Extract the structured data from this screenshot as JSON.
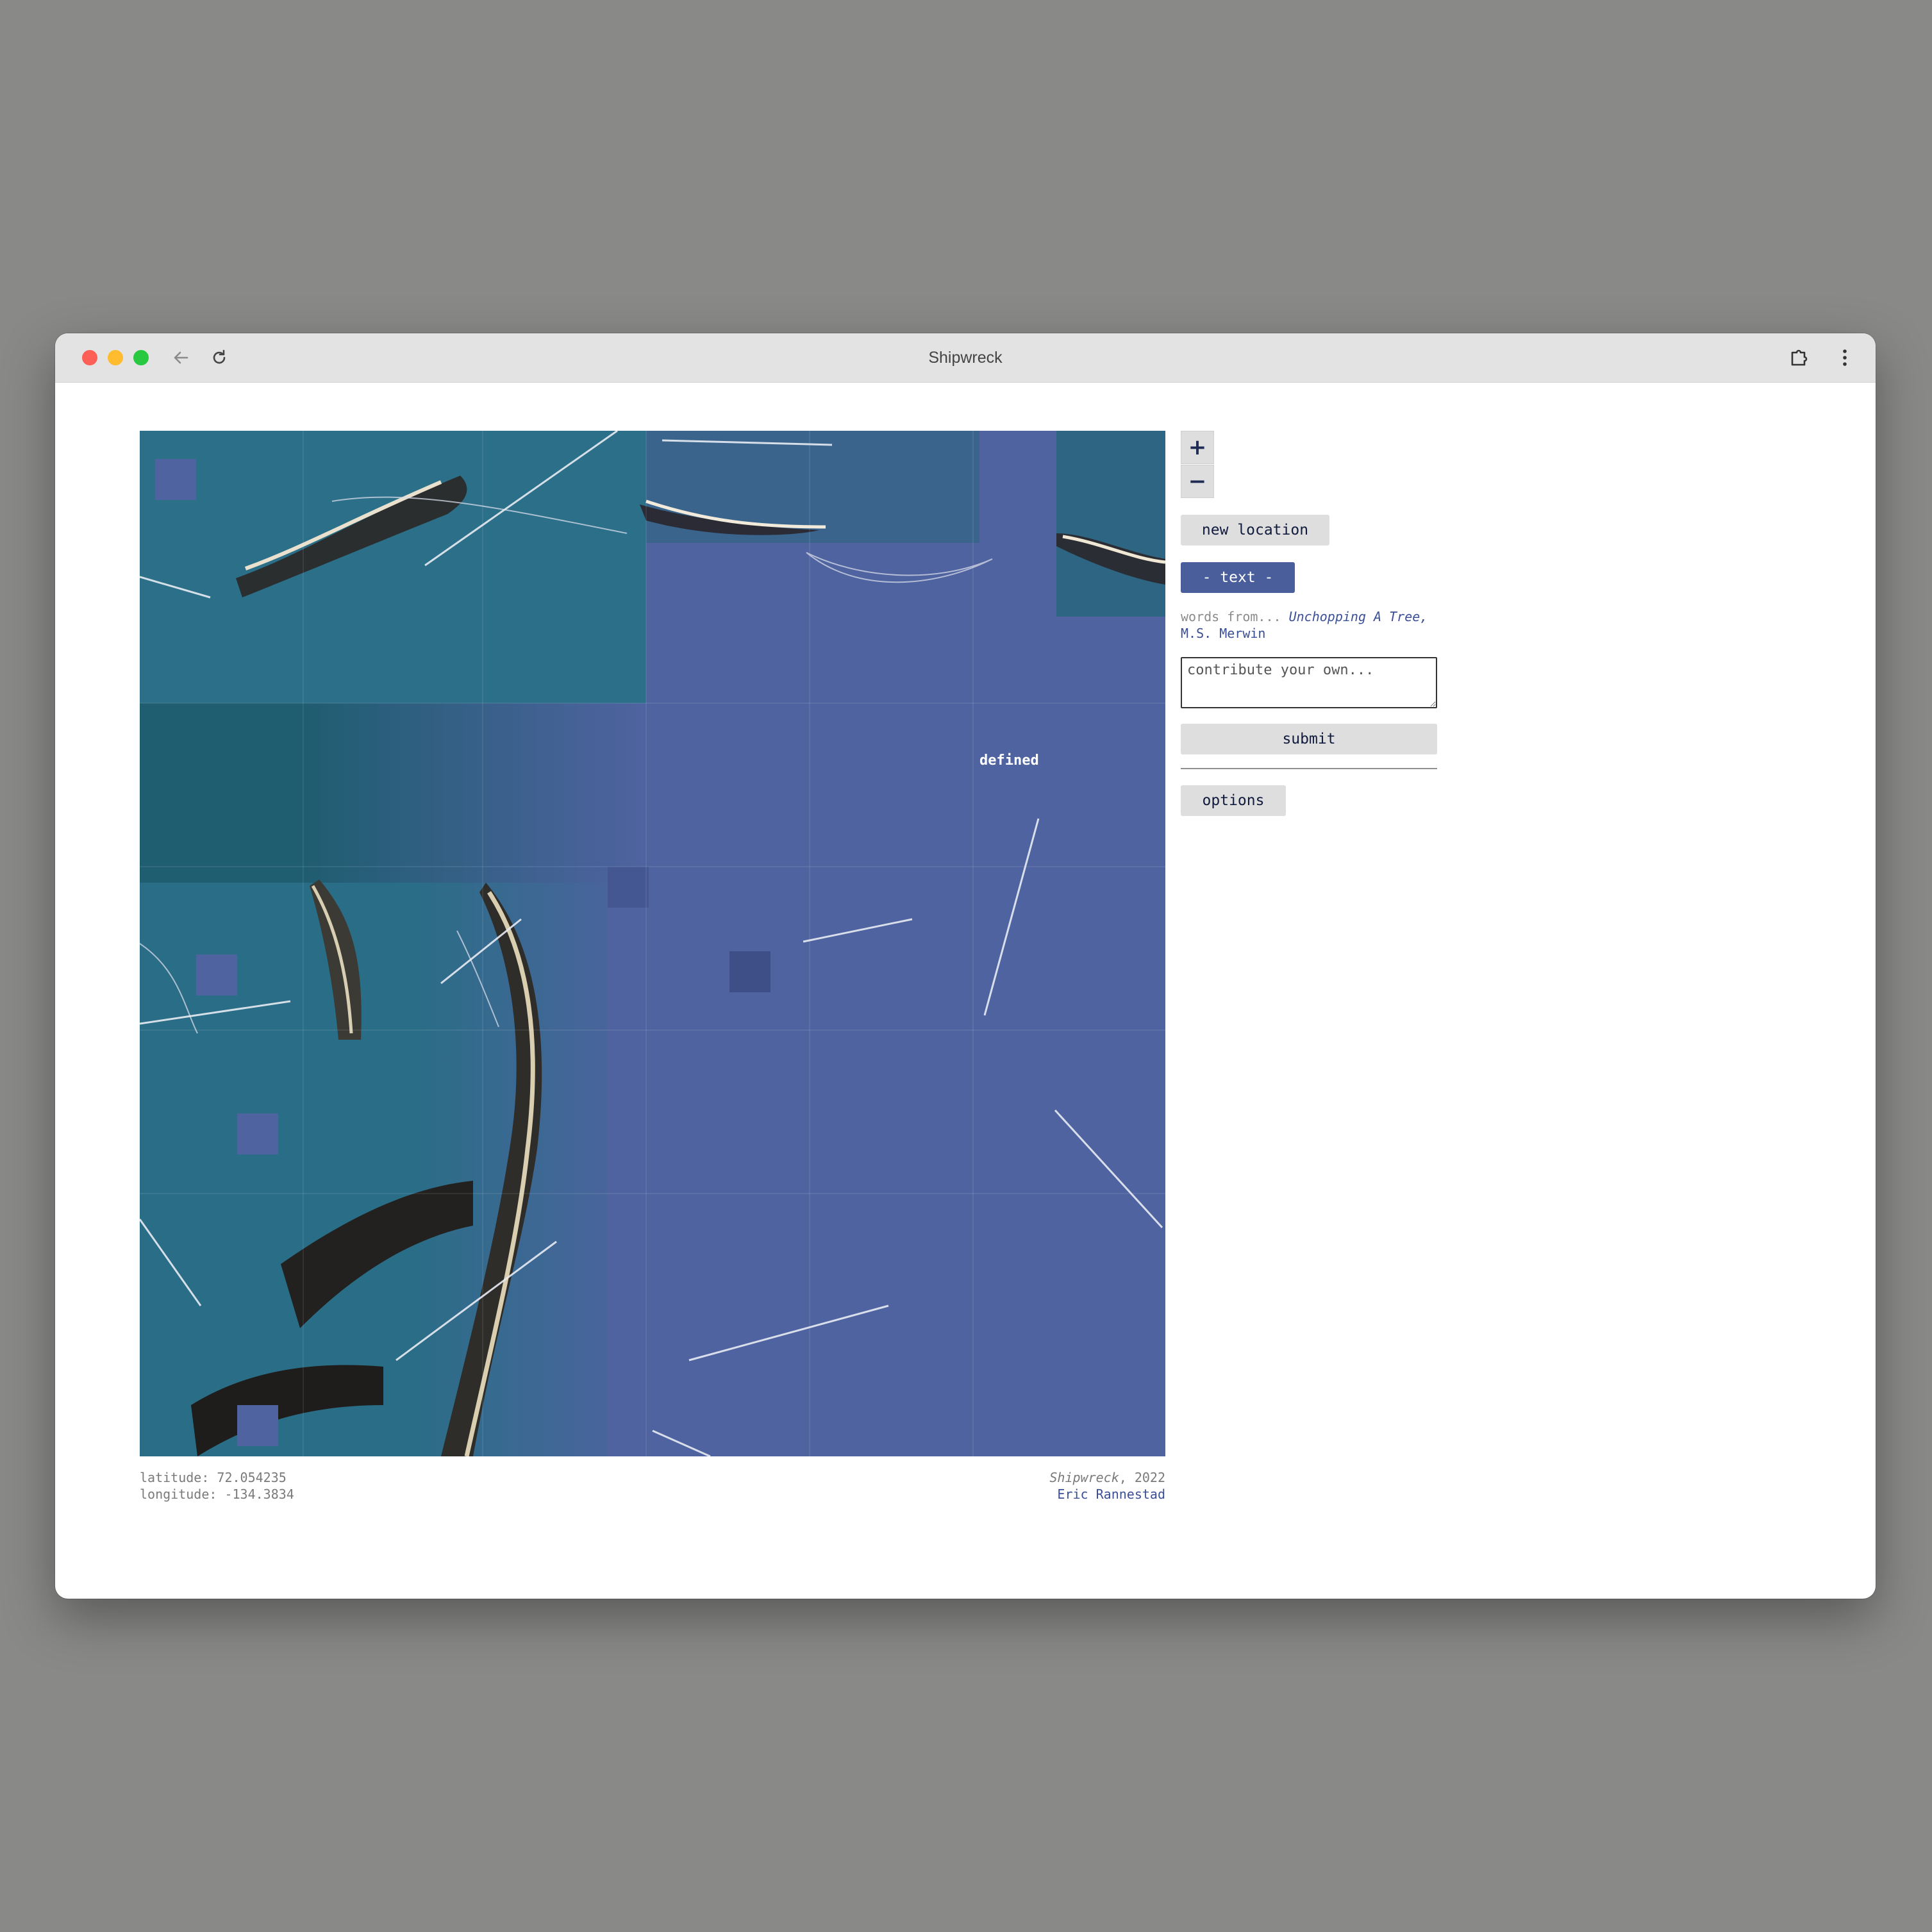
{
  "browser": {
    "title": "Shipwreck"
  },
  "map": {
    "zoom_in_label": "+",
    "zoom_out_label": "−",
    "overlay_word": "defined"
  },
  "controls": {
    "new_location_label": "new location",
    "text_toggle_label": "- text -",
    "words_from_prefix": "words from...",
    "source_title": "Unchopping A Tree,",
    "source_author": "M.S. Merwin",
    "contribute_placeholder": "contribute your own...",
    "submit_label": "submit",
    "options_label": "options"
  },
  "location": {
    "latitude_text": "latitude: 72.054235",
    "longitude_text": "longitude: -134.3834"
  },
  "credit": {
    "work_title": "Shipwreck",
    "year_text": ", 2022",
    "artist": "Eric Rannestad"
  },
  "colors": {
    "overlay_blue": "#4f63a0",
    "water": "#2a6e88",
    "accent_button": "#4b5e9c",
    "link": "#3a4f95"
  }
}
